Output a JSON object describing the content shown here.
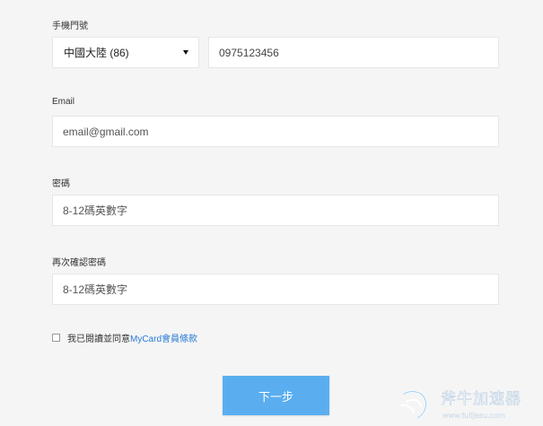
{
  "form": {
    "phone": {
      "label": "手機門號",
      "country_selected": "中國大陸 (86)",
      "number_value": "0975123456"
    },
    "email": {
      "label": "Email",
      "placeholder": "email@gmail.com"
    },
    "password": {
      "label": "密碼",
      "placeholder": "8-12碼英數字"
    },
    "confirm_password": {
      "label": "再次確認密碼",
      "placeholder": "8-12碼英數字"
    },
    "agree": {
      "checked": false,
      "text": "我已閱讀並同意",
      "link_text": "MyCard會員條款"
    },
    "next_button": "下一步"
  },
  "watermark": {
    "title": "斧牛加速器",
    "url": "www.fuiijasu.com"
  },
  "colors": {
    "background": "#f5f5f5",
    "button": "#5aaef0",
    "link": "#2a7ad6"
  }
}
